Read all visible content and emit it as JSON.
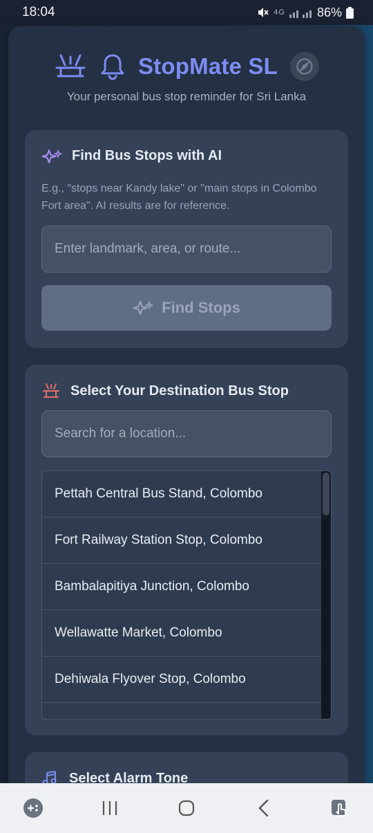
{
  "status_bar": {
    "time": "18:04",
    "battery": "86%",
    "network": "4G"
  },
  "app": {
    "title": "StopMate SL",
    "tagline": "Your personal bus stop reminder for Sri Lanka",
    "accent_color": "#7d8cf3"
  },
  "ai_search": {
    "title": "Find Bus Stops with AI",
    "description": "E.g., \"stops near Kandy lake\" or \"main stops in Colombo Fort area\". AI results are for reference.",
    "placeholder": "Enter landmark, area, or route...",
    "button_label": "Find Stops"
  },
  "destination": {
    "title": "Select Your Destination Bus Stop",
    "placeholder": "Search for a location...",
    "stops": [
      "Pettah Central Bus Stand, Colombo",
      "Fort Railway Station Stop, Colombo",
      "Bambalapitiya Junction, Colombo",
      "Wellawatte Market, Colombo",
      "Dehiwala Flyover Stop, Colombo",
      ""
    ]
  },
  "alarm": {
    "title": "Select Alarm Tone"
  },
  "icons": {
    "header": [
      "bus-stop-icon",
      "bell-icon",
      "compass-icon"
    ],
    "ai": "sparkle-icon",
    "destination": "bus-stop-icon",
    "alarm": "music-icon"
  }
}
